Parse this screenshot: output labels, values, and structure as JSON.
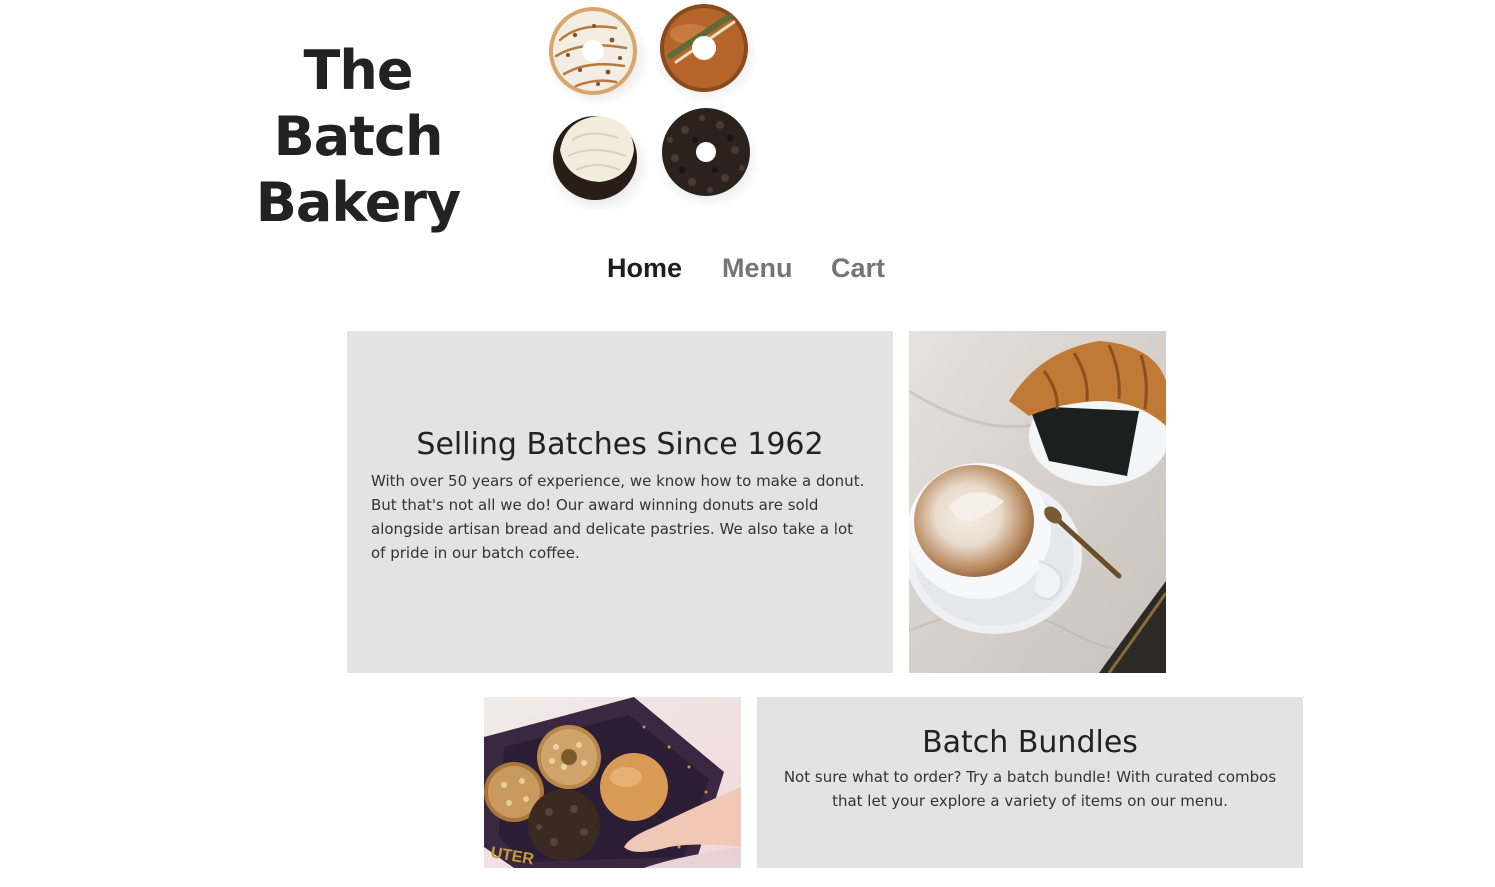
{
  "header": {
    "title_line1": "The Batch",
    "title_line2": "Bakery",
    "logo_icon": "four-donuts-logo-icon"
  },
  "nav": {
    "items": [
      {
        "label": "Home",
        "active": true
      },
      {
        "label": "Menu",
        "active": false
      },
      {
        "label": "Cart",
        "active": false
      }
    ]
  },
  "main": {
    "intro": {
      "title": "Selling Batches Since 1962",
      "body": "With over 50 years of experience, we know how to make a donut. But that's not all we do! Our award winning donuts are sold alongside artisan bread and delicate pastries. We also take a lot of pride in our batch coffee.",
      "image_icon": "coffee-croissant-photo-icon"
    },
    "bundles": {
      "title": "Batch Bundles",
      "body": "Not sure what to order? Try a batch bundle! With curated combos that let your explore a variety of items on our menu.",
      "image_icon": "donut-box-photo-icon"
    }
  },
  "colors": {
    "card_background": "#e4e3e4",
    "nav_active": "#1e1e1e",
    "nav_inactive": "#757575",
    "text_dark": "#222222"
  }
}
